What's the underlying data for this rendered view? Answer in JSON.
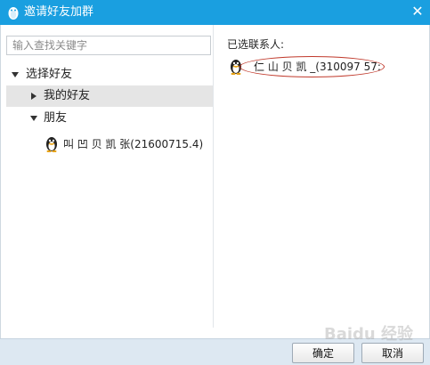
{
  "window": {
    "title": "邀请好友加群",
    "close_glyph": "✕"
  },
  "search": {
    "placeholder": "输入查找关键字",
    "value": ""
  },
  "tree": {
    "root_label": "选择好友",
    "groups": [
      {
        "label": "我的好友",
        "expanded": false,
        "selected": true
      },
      {
        "label": "朋友",
        "expanded": true,
        "selected": false
      }
    ],
    "contacts": [
      {
        "display": "叫 凹 贝 凯 张(21600715.4)",
        "icon": "qq-penguin-avatar-icon"
      }
    ]
  },
  "selected_panel": {
    "heading": "已选联系人:",
    "contacts": [
      {
        "display": "仁 山 贝 凯 _(310097 57:",
        "icon": "qq-penguin-avatar-icon"
      }
    ]
  },
  "buttons": {
    "confirm": "确定",
    "cancel": "取消"
  },
  "watermark": "Baidu 经验",
  "colors": {
    "titlebar": "#1a9fe0",
    "selected_row": "#e5e5e5",
    "annotation_ellipse": "#c0392b",
    "footer": "#dde8f2"
  }
}
